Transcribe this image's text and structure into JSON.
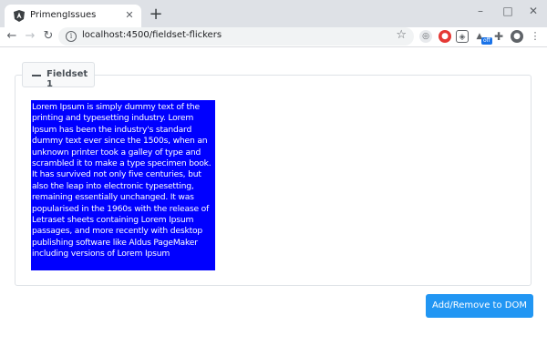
{
  "browser": {
    "tab": {
      "title": "PrimengIssues",
      "close_glyph": "✕",
      "favicon": "angular-icon"
    },
    "new_tab_glyph": "+",
    "window_controls": {
      "minimize": "–",
      "maximize": "□",
      "close": "✕"
    },
    "nav": {
      "back": "←",
      "forward": "→",
      "reload": "↻"
    },
    "address": {
      "url": "localhost:4500/fieldset-flickers"
    },
    "extensions": [
      "camera-icon",
      "ublock-icon",
      "shield-icon",
      "extension-off-icon",
      "puzzle-icon",
      "profile-icon",
      "menu-icon"
    ],
    "ext_badge": "off"
  },
  "page": {
    "fieldset": {
      "legend": "Fieldset 1",
      "content": "Lorem Ipsum is simply dummy text of the printing and typesetting industry. Lorem Ipsum has been the industry's standard dummy text ever since the 1500s, when an unknown printer took a galley of type and scrambled it to make a type specimen book. It has survived not only five centuries, but also the leap into electronic typesetting, remaining essentially unchanged. It was popularised in the 1960s with the release of Letraset sheets containing Lorem Ipsum passages, and more recently with desktop publishing software like Aldus PageMaker including versions of Lorem Ipsum"
    },
    "button_label": "Add/Remove to DOM"
  },
  "colors": {
    "content_bg": "#0000ff",
    "button_bg": "#2196f3",
    "tabstrip_bg": "#dee1e6"
  }
}
